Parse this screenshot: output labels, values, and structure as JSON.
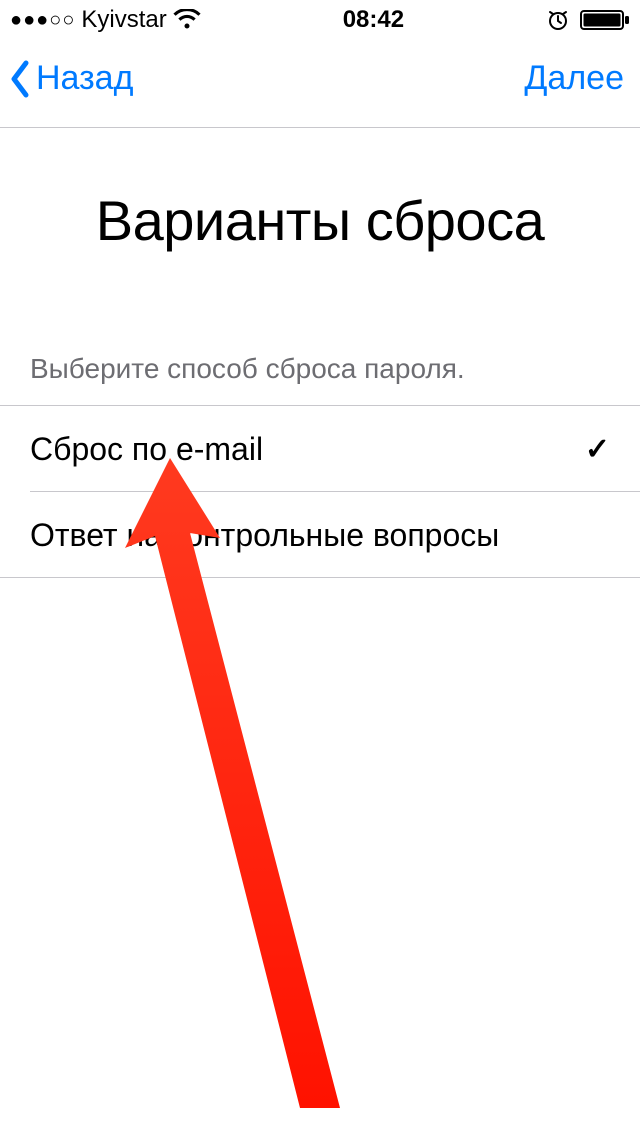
{
  "status": {
    "carrier": "Kyivstar",
    "time": "08:42"
  },
  "nav": {
    "back": "Назад",
    "next": "Далее"
  },
  "title": "Варианты сброса",
  "subtitle": "Выберите способ сброса пароля.",
  "options": [
    {
      "label": "Сброс по e-mail",
      "selected": true
    },
    {
      "label": "Ответ на контрольные вопросы",
      "selected": false
    }
  ]
}
